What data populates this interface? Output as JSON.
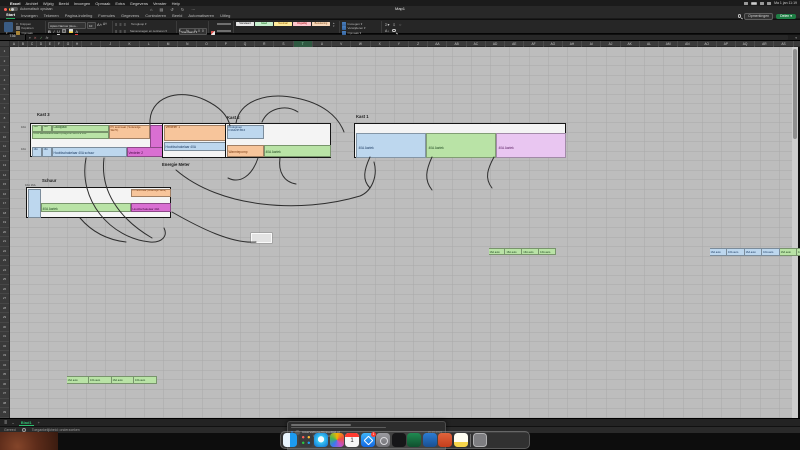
{
  "menubar": {
    "apple": "",
    "items": [
      "Excel",
      "Archief",
      "Wijzig",
      "Beeld",
      "Invoegen",
      "Opmaak",
      "Extra",
      "Gegevens",
      "Venster",
      "Help"
    ],
    "clock": "Ma 1 jan 11:19"
  },
  "titlebar": {
    "autosave": "Automatisch opslaan",
    "title": "Map1"
  },
  "tabs": {
    "items": [
      "Start",
      "Invoegen",
      "Tekenen",
      "Pagina-indeling",
      "Formules",
      "Gegevens",
      "Controleren",
      "Beeld",
      "Automatiseren",
      "Uitleg"
    ],
    "active": "Start",
    "comments": "Opmerkingen",
    "share": "Delen"
  },
  "ribbon": {
    "clipboard": [
      "Knippen",
      "Kopiëren",
      "Opmaak"
    ],
    "font_name": "Aptos Narrow (Hoo...",
    "font_size": "10",
    "wrap": "Terugloop",
    "merge": "Samenvoegen en centreren",
    "number_format": "Standaard",
    "styles": [
      [
        "Standaard",
        "Goed",
        "Neutraal",
        "Ongeldig",
        "Berekening"
      ],
      [
        "Controlecel",
        "Gekoppelde cel",
        "Invoer",
        "Notitie",
        "Uitvoer"
      ]
    ],
    "cells": [
      "Invoegen",
      "Verwijderen",
      "Opmaak"
    ]
  },
  "formula_bar": {
    "name_box": "T36"
  },
  "grid": {
    "columns": [
      "A",
      "B",
      "C",
      "D",
      "E",
      "F",
      "G",
      "H",
      "I",
      "J",
      "K",
      "L",
      "M",
      "N",
      "O",
      "P",
      "Q",
      "R",
      "S",
      "T",
      "U",
      "V",
      "W",
      "X",
      "Y",
      "Z",
      "AA",
      "AB",
      "AC",
      "AD",
      "AE",
      "AF",
      "AG",
      "AH",
      "AI",
      "AJ",
      "AK",
      "AL",
      "AM",
      "AN",
      "AO",
      "AP",
      "AQ",
      "AR",
      "AS"
    ],
    "row_count": 39,
    "selected_column": "T"
  },
  "sheet": {
    "kast3": {
      "label": "Kast 3",
      "outside1": "16A",
      "outside2": "16A",
      "prefix_row1": [
        "16A",
        "16A"
      ],
      "laadpaal": "Laadpaal",
      "pv": "PV automaat (:Solaredge SE7K)",
      "chint": "Chint aardlekautomaat 2-polig+nul 40A B-k B16",
      "prefix_row3": [
        "16A",
        "16A"
      ],
      "hoofdschakelaar": "Hoofdschakelaar 40A schuur",
      "verdeler2": "Verdeler 2"
    },
    "verdeler1": {
      "title": "Verdeler 1",
      "hoofdschakelaar": "Hoofdschakelaar 40A",
      "energie": "Energie Meter"
    },
    "kast2": {
      "label": "Kast 2",
      "kookgroep": "Kookgroep",
      "kookgroep2": "F3A62PI B16",
      "autos": [
        "16A auto",
        "16A auto",
        "16A auto",
        "16A auto"
      ],
      "warmtepomp": "Warmtepomp",
      "aarlek": "40A Aarlek"
    },
    "kast1": {
      "label": "Kast 1",
      "autos": [
        "16A auto",
        "16A auto",
        "16A auto",
        "16A auto",
        "16A auto",
        "16A auto",
        "16A auto",
        "16A auto",
        "16A auto",
        "16A auto",
        "16A auto",
        "16A auto"
      ],
      "bands": [
        "40A Aarlek",
        "40A Aarlek",
        "40A Aarlek"
      ]
    },
    "schuur": {
      "label": "Schuur",
      "outside": "16A  16A",
      "autos": [
        "16A auto",
        "16A auto",
        "16A auto",
        "16A auto"
      ],
      "pv": "PV automaat (Solaredge SE3k)",
      "aarlek": "40A Aarlek",
      "hoofdschakelaar": "Hoofdschakelaar 40A"
    }
  },
  "tabbar": {
    "sheet": "Blad1",
    "add": "+"
  },
  "statusbar": {
    "ready": "Gereed",
    "accessibility": "Toegankelijkheid: onderzoeken"
  },
  "notification": {
    "sender": "reservations@traveldel.nl",
    "subject": "Reservering Dutch Week",
    "date": "26-03-2024"
  },
  "dock": {
    "apps": [
      "Finder",
      "Launchpad",
      "Safari",
      "Foto's",
      "Agenda",
      "App Store",
      "Systeeminstellingen",
      "App",
      "Excel",
      "Word",
      "PowerPoint",
      "Notities",
      "Prullenmand"
    ],
    "calendar_day": "1",
    "badge": "1"
  },
  "colors": {
    "green": "#b9e3a6",
    "blue": "#bdd7ee",
    "orange": "#f7c59b",
    "magenta": "#d96fd2",
    "pink": "#e9c6f1",
    "accent": "#27ae60"
  }
}
